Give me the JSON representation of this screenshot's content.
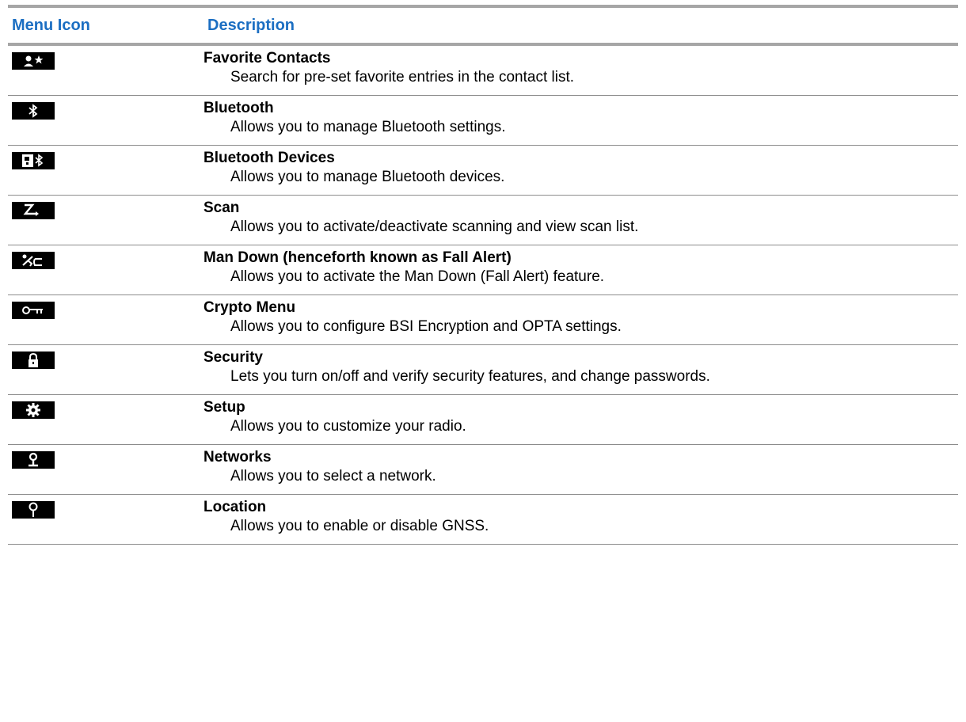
{
  "header": {
    "col_icon": "Menu Icon",
    "col_desc": "Description"
  },
  "rows": [
    {
      "icon": "favorite-contacts-icon",
      "title": "Favorite Contacts",
      "desc": "Search for pre-set favorite entries in the contact list."
    },
    {
      "icon": "bluetooth-icon",
      "title": "Bluetooth",
      "desc": "Allows you to manage Bluetooth settings."
    },
    {
      "icon": "bluetooth-devices-icon",
      "title": "Bluetooth Devices",
      "desc": "Allows you to manage Bluetooth devices."
    },
    {
      "icon": "scan-icon",
      "title": "Scan",
      "desc": "Allows you to activate/deactivate scanning and view scan list."
    },
    {
      "icon": "man-down-icon",
      "title": "Man Down (henceforth known as Fall Alert)",
      "desc": "Allows you to activate the Man Down (Fall Alert) feature."
    },
    {
      "icon": "key-icon",
      "title": "Crypto Menu",
      "desc": "Allows you to configure BSI Encryption and OPTA settings."
    },
    {
      "icon": "lock-icon",
      "title": "Security",
      "desc": "Lets you turn on/off and verify security features, and change passwords."
    },
    {
      "icon": "gear-icon",
      "title": "Setup",
      "desc": "Allows you to customize your radio."
    },
    {
      "icon": "network-icon",
      "title": "Networks",
      "desc": "Allows you to select a network."
    },
    {
      "icon": "location-pin-icon",
      "title": "Location",
      "desc": "Allows you to enable or disable GNSS."
    }
  ],
  "colors": {
    "header_text": "#1b6ec2",
    "rule": "#a6a6a6",
    "icon_bg": "#000000"
  }
}
